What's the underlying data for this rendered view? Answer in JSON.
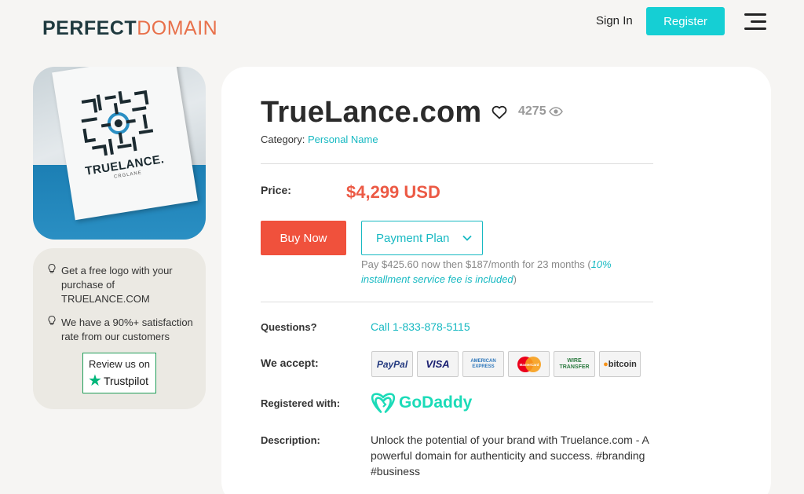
{
  "header": {
    "logo_part1": "PERFECT",
    "logo_part2": "DOMAIN",
    "signin_label": "Sign In",
    "register_label": "Register"
  },
  "sidebar": {
    "logo_image_brand": "TRUELANCE.",
    "logo_image_sub": "CRGLANE",
    "tips": [
      "Get a free logo with your purchase of TRUELANCE.COM",
      "We have a 90%+ satisfaction rate from our customers"
    ],
    "review_line": "Review us on",
    "review_brand": "Trustpilot"
  },
  "listing": {
    "domain": "TrueLance.com",
    "views": "4275",
    "category_label": "Category:",
    "category": "Personal Name",
    "price_label": "Price:",
    "price": "$4,299 USD",
    "buy_label": "Buy Now",
    "plan_label": "Payment Plan",
    "plan_note": "Pay $425.60 now then $187/month for 23 months (",
    "plan_fee": "10% installment service fee is included",
    "plan_close": ")",
    "questions_label": "Questions?",
    "phone": "Call 1-833-878-5115",
    "accept_label": "We accept:",
    "payment_methods": [
      "PayPal",
      "VISA",
      "AMERICAN EXPRESS",
      "MasterCard",
      "WIRE TRANSFER",
      "bitcoin"
    ],
    "registered_label": "Registered with:",
    "registrar": "GoDaddy",
    "description_label": "Description:",
    "description": "Unlock the potential of your brand with Truelance.com - A powerful domain for authenticity and success. #branding #business"
  },
  "colors": {
    "accent": "#15cfd4",
    "price": "#ec5a45",
    "buy": "#f0513c",
    "trustpilot": "#00b67a",
    "godaddy": "#1bdbb8"
  }
}
